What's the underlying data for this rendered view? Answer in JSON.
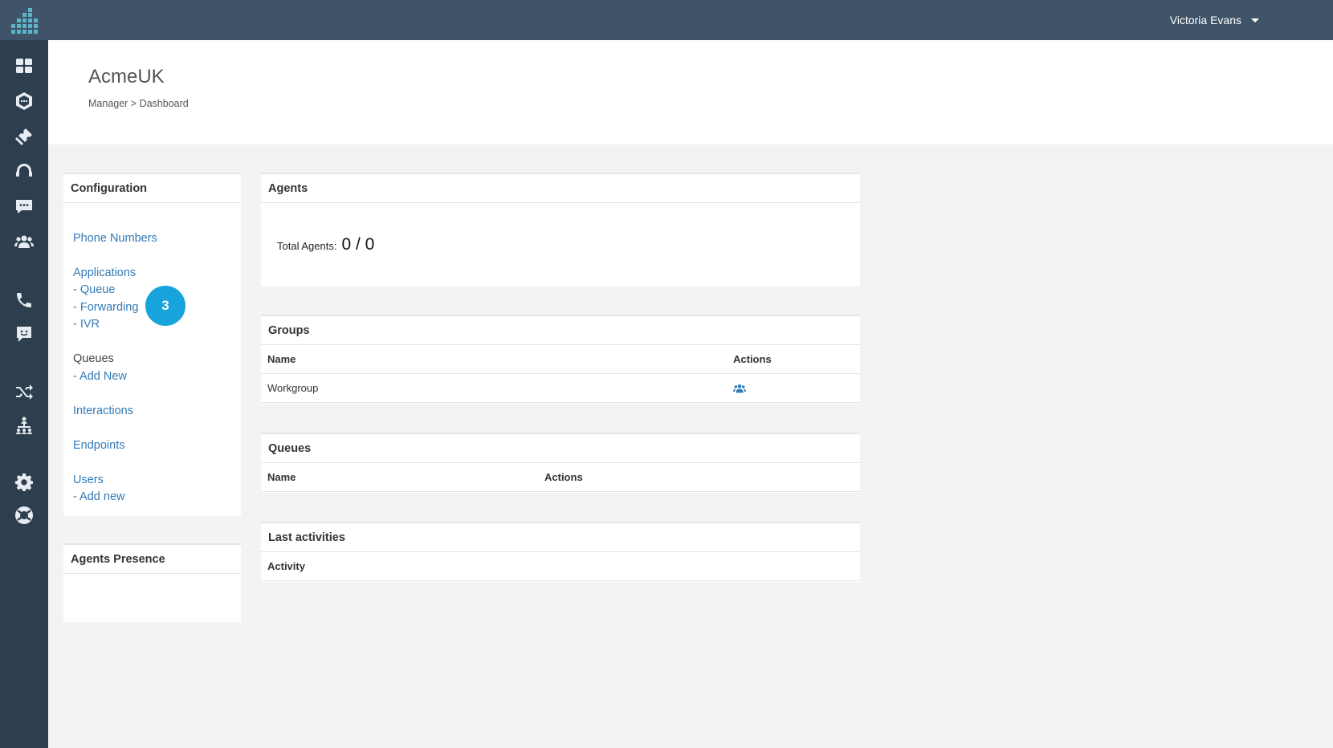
{
  "app": {
    "account_name": "AcmeUK"
  },
  "user": {
    "name": "Victoria Evans"
  },
  "breadcrumb": "Manager > Dashboard",
  "sidebar_icons": [
    "dashboard-icon",
    "hexagon-chat-icon",
    "ticket-icon",
    "headset-icon",
    "chat-bubble-icon",
    "users-icon",
    "phone-icon",
    "sms-icon",
    "shuffle-icon",
    "hierarchy-icon",
    "gear-icon",
    "lifebuoy-icon"
  ],
  "configuration": {
    "title": "Configuration",
    "phone_numbers": "Phone Numbers",
    "applications": "Applications",
    "app_queue": "- Queue",
    "app_forwarding": "- Forwarding",
    "app_ivr": "- IVR",
    "queues": "Queues",
    "queues_add": "- Add New",
    "interactions": "Interactions",
    "endpoints": "Endpoints",
    "users": "Users",
    "users_add": "- Add new"
  },
  "step_badge": "3",
  "agents_presence": {
    "title": "Agents Presence"
  },
  "agents": {
    "title": "Agents",
    "total_label": "Total Agents:",
    "total_value": "0 / 0"
  },
  "groups": {
    "title": "Groups",
    "columns": [
      "Name",
      "Actions"
    ],
    "rows": [
      {
        "name": "Workgroup",
        "action_icon": "users-icon"
      }
    ]
  },
  "queues_panel": {
    "title": "Queues",
    "columns": [
      "Name",
      "Actions"
    ]
  },
  "last_activities": {
    "title": "Last activities",
    "columns": [
      "Activity"
    ]
  },
  "colors": {
    "topbar": "#3f5468",
    "sidebar": "#2d3e4e",
    "link": "#337ab7",
    "badge": "#17a3db"
  }
}
